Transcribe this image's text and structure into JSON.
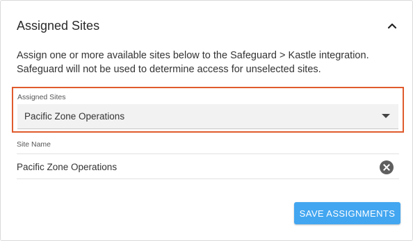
{
  "panel": {
    "title": "Assigned Sites",
    "collapse_icon": "chevron-up-icon"
  },
  "description": "Assign one or more available sites below to the Safeguard > Kastle integration. Safeguard will not be used to determine access for unselected sites.",
  "site_select": {
    "label": "Assigned Sites",
    "value": "Pacific Zone Operations",
    "highlight_color": "#e05a2c"
  },
  "sites_table": {
    "column_header": "Site Name",
    "rows": [
      {
        "name": "Pacific Zone Operations",
        "remove_icon": "close-circle-icon"
      }
    ]
  },
  "actions": {
    "save_label": "SAVE ASSIGNMENTS",
    "save_color": "#43a6f0"
  }
}
